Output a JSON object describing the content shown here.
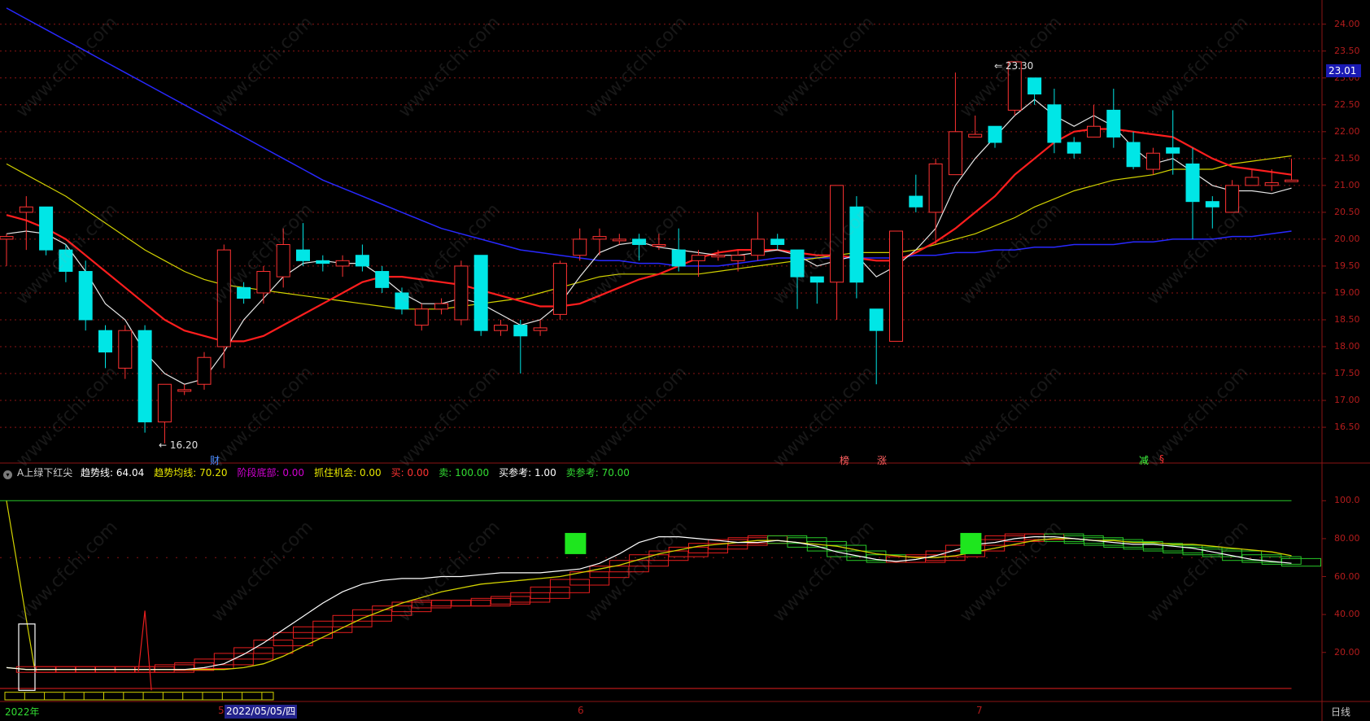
{
  "chart_data": {
    "type": "candlestick",
    "price_axis": {
      "min": 16.0,
      "max": 24.3,
      "ticks": [
        "24.00",
        "23.50",
        "23.00",
        "22.50",
        "22.00",
        "21.50",
        "21.00",
        "20.50",
        "20.00",
        "19.50",
        "19.00",
        "18.50",
        "18.00",
        "17.50",
        "17.00",
        "16.50"
      ]
    },
    "last_price_label": "23.01",
    "high_annotation": "23.30",
    "low_annotation": "16.20",
    "candles": [
      [
        20.0,
        20.05,
        19.5,
        20.1
      ],
      [
        20.5,
        20.6,
        19.8,
        20.8
      ],
      [
        20.6,
        19.8,
        19.7,
        20.6
      ],
      [
        19.8,
        19.4,
        19.2,
        19.9
      ],
      [
        19.4,
        18.5,
        18.3,
        19.6
      ],
      [
        18.3,
        17.9,
        17.6,
        18.4
      ],
      [
        17.6,
        18.3,
        17.4,
        18.4
      ],
      [
        18.3,
        16.6,
        16.4,
        18.4
      ],
      [
        16.6,
        17.3,
        16.2,
        17.3
      ],
      [
        17.2,
        17.2,
        17.1,
        17.3
      ],
      [
        17.3,
        17.8,
        17.2,
        17.9
      ],
      [
        18.0,
        19.8,
        17.6,
        19.9
      ],
      [
        19.1,
        18.9,
        18.8,
        19.2
      ],
      [
        19.0,
        19.4,
        18.8,
        19.5
      ],
      [
        19.3,
        19.9,
        19.1,
        20.2
      ],
      [
        19.8,
        19.6,
        19.5,
        20.3
      ],
      [
        19.6,
        19.55,
        19.4,
        19.7
      ],
      [
        19.5,
        19.6,
        19.3,
        19.7
      ],
      [
        19.7,
        19.5,
        19.4,
        19.9
      ],
      [
        19.4,
        19.1,
        19.0,
        19.5
      ],
      [
        19.0,
        18.7,
        18.6,
        19.1
      ],
      [
        18.4,
        18.7,
        18.3,
        18.8
      ],
      [
        18.7,
        18.8,
        18.6,
        18.9
      ],
      [
        18.5,
        19.5,
        18.4,
        19.6
      ],
      [
        19.7,
        18.3,
        18.2,
        19.7
      ],
      [
        18.3,
        18.4,
        18.2,
        18.5
      ],
      [
        18.4,
        18.2,
        17.5,
        18.5
      ],
      [
        18.3,
        18.35,
        18.2,
        18.5
      ],
      [
        18.6,
        19.55,
        18.5,
        19.6
      ],
      [
        19.7,
        20.0,
        19.6,
        20.2
      ],
      [
        20.0,
        20.05,
        19.7,
        20.2
      ],
      [
        20.0,
        20.0,
        19.9,
        20.1
      ],
      [
        20.0,
        19.9,
        19.6,
        20.1
      ],
      [
        19.9,
        19.9,
        19.8,
        20.1
      ],
      [
        19.8,
        19.5,
        19.4,
        20.2
      ],
      [
        19.6,
        19.7,
        19.3,
        19.8
      ],
      [
        19.7,
        19.7,
        19.6,
        19.8
      ],
      [
        19.6,
        19.7,
        19.4,
        19.8
      ],
      [
        19.7,
        20.0,
        19.6,
        20.5
      ],
      [
        20.0,
        19.9,
        19.8,
        20.1
      ],
      [
        19.8,
        19.3,
        18.7,
        19.8
      ],
      [
        19.3,
        19.2,
        18.8,
        19.3
      ],
      [
        19.2,
        21.0,
        18.5,
        21.0
      ],
      [
        20.6,
        19.2,
        18.9,
        20.8
      ],
      [
        18.7,
        18.3,
        17.3,
        18.7
      ],
      [
        18.1,
        20.15,
        18.1,
        20.15
      ],
      [
        20.8,
        20.6,
        20.5,
        21.2
      ],
      [
        20.5,
        21.4,
        19.9,
        21.5
      ],
      [
        21.2,
        22.0,
        21.2,
        23.1
      ],
      [
        21.9,
        21.95,
        21.9,
        22.3
      ],
      [
        22.1,
        21.8,
        21.7,
        22.1
      ],
      [
        22.4,
        23.3,
        22.3,
        23.3
      ],
      [
        23.0,
        22.7,
        22.5,
        23.0
      ],
      [
        22.5,
        21.8,
        21.6,
        22.8
      ],
      [
        21.8,
        21.6,
        21.5,
        21.9
      ],
      [
        21.9,
        22.1,
        21.9,
        22.5
      ],
      [
        22.4,
        21.9,
        21.7,
        22.8
      ],
      [
        21.8,
        21.35,
        21.3,
        22.0
      ],
      [
        21.3,
        21.6,
        21.2,
        21.7
      ],
      [
        21.7,
        21.6,
        21.2,
        22.4
      ],
      [
        21.4,
        20.7,
        20.0,
        21.7
      ],
      [
        20.7,
        20.6,
        20.2,
        20.8
      ],
      [
        20.5,
        21.0,
        20.5,
        21.1
      ],
      [
        21.0,
        21.15,
        21.0,
        21.3
      ],
      [
        21.0,
        21.05,
        20.9,
        21.3
      ],
      [
        21.1,
        21.1,
        21.1,
        21.5
      ]
    ],
    "ma_white": [
      20.1,
      20.15,
      20.1,
      19.9,
      19.4,
      18.8,
      18.5,
      17.9,
      17.5,
      17.3,
      17.4,
      17.9,
      18.5,
      18.9,
      19.3,
      19.55,
      19.6,
      19.55,
      19.55,
      19.3,
      19.0,
      18.8,
      18.8,
      18.9,
      18.8,
      18.6,
      18.4,
      18.5,
      18.8,
      19.3,
      19.75,
      19.9,
      19.95,
      19.85,
      19.8,
      19.75,
      19.7,
      19.7,
      19.75,
      19.8,
      19.7,
      19.5,
      19.6,
      19.7,
      19.3,
      19.5,
      19.8,
      20.2,
      21.0,
      21.5,
      21.9,
      22.3,
      22.6,
      22.3,
      22.1,
      22.3,
      22.1,
      21.7,
      21.4,
      21.5,
      21.25,
      21.0,
      20.9,
      20.9,
      20.85,
      20.95
    ],
    "ma_red": [
      20.45,
      20.35,
      20.2,
      20.0,
      19.7,
      19.4,
      19.1,
      18.8,
      18.5,
      18.3,
      18.2,
      18.1,
      18.1,
      18.2,
      18.4,
      18.6,
      18.8,
      19.0,
      19.2,
      19.3,
      19.3,
      19.25,
      19.2,
      19.15,
      19.05,
      18.95,
      18.85,
      18.75,
      18.75,
      18.8,
      18.95,
      19.1,
      19.25,
      19.35,
      19.5,
      19.65,
      19.75,
      19.8,
      19.8,
      19.8,
      19.75,
      19.7,
      19.7,
      19.65,
      19.6,
      19.6,
      19.75,
      19.95,
      20.2,
      20.5,
      20.8,
      21.2,
      21.5,
      21.8,
      22.0,
      22.05,
      22.05,
      22.0,
      21.95,
      21.9,
      21.7,
      21.5,
      21.35,
      21.3,
      21.25,
      21.2
    ],
    "ma_yellow": [
      21.4,
      21.2,
      21.0,
      20.8,
      20.55,
      20.3,
      20.05,
      19.8,
      19.6,
      19.4,
      19.25,
      19.15,
      19.1,
      19.05,
      19.0,
      18.95,
      18.9,
      18.85,
      18.8,
      18.75,
      18.7,
      18.7,
      18.7,
      18.75,
      18.8,
      18.85,
      18.9,
      19.0,
      19.1,
      19.2,
      19.3,
      19.35,
      19.35,
      19.35,
      19.35,
      19.35,
      19.4,
      19.45,
      19.5,
      19.55,
      19.6,
      19.65,
      19.7,
      19.75,
      19.75,
      19.75,
      19.8,
      19.9,
      20.0,
      20.1,
      20.25,
      20.4,
      20.6,
      20.75,
      20.9,
      21.0,
      21.1,
      21.15,
      21.2,
      21.3,
      21.3,
      21.3,
      21.4,
      21.45,
      21.5,
      21.55
    ],
    "ma_blue": [
      24.3,
      24.1,
      23.9,
      23.7,
      23.5,
      23.3,
      23.1,
      22.9,
      22.7,
      22.5,
      22.3,
      22.1,
      21.9,
      21.7,
      21.5,
      21.3,
      21.1,
      20.95,
      20.8,
      20.65,
      20.5,
      20.35,
      20.2,
      20.1,
      20.0,
      19.9,
      19.8,
      19.75,
      19.7,
      19.65,
      19.6,
      19.6,
      19.55,
      19.55,
      19.5,
      19.5,
      19.5,
      19.55,
      19.6,
      19.65,
      19.65,
      19.65,
      19.65,
      19.65,
      19.65,
      19.65,
      19.7,
      19.7,
      19.75,
      19.75,
      19.8,
      19.8,
      19.85,
      19.85,
      19.9,
      19.9,
      19.9,
      19.95,
      19.95,
      20.0,
      20.0,
      20.0,
      20.05,
      20.05,
      20.1,
      20.15
    ],
    "indicator": {
      "name": "A上绿下红尖",
      "axis_ticks": [
        "100.0",
        "80.00",
        "60.00",
        "40.00",
        "20.00"
      ],
      "range": [
        0,
        105
      ],
      "trend_line": [
        12,
        11,
        11,
        11,
        11,
        11,
        11,
        11,
        11,
        11,
        12,
        14,
        19,
        25,
        32,
        39,
        46,
        52,
        56,
        58,
        59,
        59,
        60,
        60,
        61,
        62,
        62,
        62,
        63,
        64,
        67,
        72,
        78,
        81,
        81,
        80,
        79,
        78,
        78,
        79,
        78,
        76,
        73,
        71,
        69,
        68,
        69,
        71,
        74,
        77,
        78,
        80,
        81,
        81,
        80,
        79,
        78,
        77,
        77,
        76,
        75,
        73,
        71,
        69,
        68,
        67
      ],
      "trend_avg": [
        12,
        11,
        11,
        11,
        11,
        11,
        11,
        11,
        11,
        11,
        11,
        11,
        12,
        14,
        18,
        23,
        28,
        33,
        38,
        42,
        46,
        49,
        52,
        54,
        56,
        57,
        58,
        59,
        60,
        62,
        64,
        66,
        69,
        72,
        74,
        76,
        77,
        78,
        79,
        79,
        78,
        77,
        76,
        74,
        72,
        71,
        70,
        70,
        71,
        73,
        75,
        77,
        79,
        80,
        80,
        79,
        79,
        78,
        78,
        77,
        77,
        76,
        75,
        74,
        73,
        71
      ],
      "stair": [
        11,
        11,
        11,
        11,
        11,
        11,
        11,
        11,
        12,
        13,
        15,
        18,
        21,
        25,
        29,
        32,
        35,
        38,
        41,
        43,
        45,
        46,
        46,
        46,
        47,
        48,
        50,
        53,
        57,
        61,
        64,
        67,
        70,
        72,
        74,
        76,
        78,
        79,
        80,
        79,
        77,
        75,
        72,
        70,
        69,
        69,
        70,
        72,
        75,
        78,
        80,
        81,
        81,
        80,
        79,
        78,
        77,
        76,
        75,
        74,
        73,
        72,
        70,
        69,
        68,
        67
      ],
      "spike": 42,
      "values": [
        {
          "label": "趋势线:",
          "value": "64.04",
          "color": "#ffffff"
        },
        {
          "label": "趋势均线:",
          "value": "70.20",
          "color": "#e6e600"
        },
        {
          "label": "阶段底部:",
          "value": "0.00",
          "color": "#d200d2"
        },
        {
          "label": "抓住机会:",
          "value": "0.00",
          "color": "#e6e600"
        },
        {
          "label": "买:",
          "value": "0.00",
          "color": "#ff3232"
        },
        {
          "label": "卖:",
          "value": "100.00",
          "color": "#32dc32"
        },
        {
          "label": "买参考:",
          "value": "1.00",
          "color": "#ffffff"
        },
        {
          "label": "卖参考:",
          "value": "70.00",
          "color": "#32dc32"
        }
      ]
    }
  },
  "labels": {
    "events": [
      {
        "text": "财",
        "color": "#4a8cff"
      },
      {
        "text": "榜",
        "color": "#ff6060"
      },
      {
        "text": "涨",
        "color": "#ff6060"
      },
      {
        "text": "减",
        "color": "#40ff40"
      },
      {
        "text": "§",
        "color": "#ff3232"
      }
    ],
    "x_ticks": [
      "2022年",
      "5",
      "6",
      "7"
    ],
    "selected_date": "2022/05/05/四",
    "period": "日线",
    "watermark": "www.cfchi.com"
  },
  "colors": {
    "up": "#ff3232",
    "down": "#00e6e6",
    "grid": "#8c1414"
  }
}
